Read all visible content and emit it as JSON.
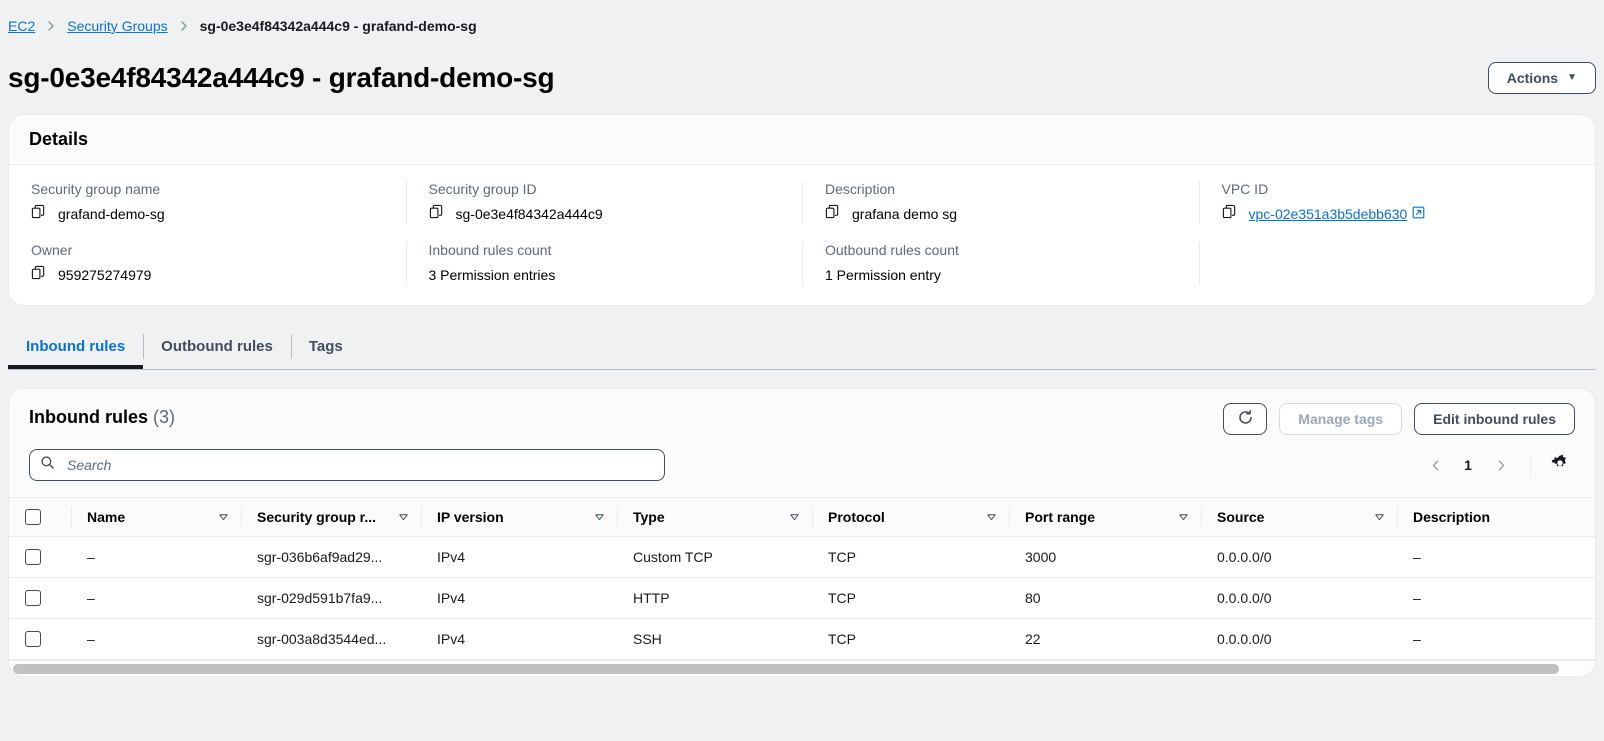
{
  "breadcrumb": {
    "items": [
      {
        "label": "EC2",
        "type": "link"
      },
      {
        "label": "Security Groups",
        "type": "link"
      },
      {
        "label": "sg-0e3e4f84342a444c9 - grafand-demo-sg",
        "type": "current"
      }
    ],
    "separator": "›"
  },
  "header": {
    "title": "sg-0e3e4f84342a444c9 - grafand-demo-sg",
    "actions_label": "Actions",
    "actions_caret": "▼"
  },
  "details": {
    "title": "Details",
    "fields": [
      {
        "label": "Security group name",
        "value": "grafand-demo-sg",
        "copyable": true,
        "link": false
      },
      {
        "label": "Security group ID",
        "value": "sg-0e3e4f84342a444c9",
        "copyable": true,
        "link": false
      },
      {
        "label": "Description",
        "value": "grafana demo sg",
        "copyable": true,
        "link": false
      },
      {
        "label": "VPC ID",
        "value": "vpc-02e351a3b5debb630",
        "copyable": true,
        "link": true
      },
      {
        "label": "Owner",
        "value": "959275274979",
        "copyable": true,
        "link": false
      },
      {
        "label": "Inbound rules count",
        "value": "3 Permission entries",
        "copyable": false,
        "link": false
      },
      {
        "label": "Outbound rules count",
        "value": "1 Permission entry",
        "copyable": false,
        "link": false
      },
      {
        "label": "",
        "value": "",
        "copyable": false,
        "link": false
      }
    ]
  },
  "tabs": [
    {
      "label": "Inbound rules",
      "active": true
    },
    {
      "label": "Outbound rules",
      "active": false
    },
    {
      "label": "Tags",
      "active": false
    }
  ],
  "table_panel": {
    "title": "Inbound rules",
    "count": "(3)",
    "refresh_icon": "refresh-icon",
    "manage_tags_label": "Manage tags",
    "manage_tags_disabled": true,
    "edit_rules_label": "Edit inbound rules",
    "search_placeholder": "Search",
    "search_value": "",
    "pagination": {
      "prev": "‹",
      "page": "1",
      "next": "›"
    },
    "settings_icon": "gear-icon"
  },
  "table": {
    "columns": [
      {
        "label": "Name",
        "sortable": true
      },
      {
        "label": "Security group r...",
        "sortable": true
      },
      {
        "label": "IP version",
        "sortable": true
      },
      {
        "label": "Type",
        "sortable": true
      },
      {
        "label": "Protocol",
        "sortable": true
      },
      {
        "label": "Port range",
        "sortable": true
      },
      {
        "label": "Source",
        "sortable": true
      },
      {
        "label": "Description",
        "sortable": false
      }
    ],
    "rows": [
      {
        "name": "–",
        "security_group_rule_id": "sgr-036b6af9ad29...",
        "ip_version": "IPv4",
        "type": "Custom TCP",
        "protocol": "TCP",
        "port_range": "3000",
        "source": "0.0.0.0/0",
        "description": "–"
      },
      {
        "name": "–",
        "security_group_rule_id": "sgr-029d591b7fa9...",
        "ip_version": "IPv4",
        "type": "HTTP",
        "protocol": "TCP",
        "port_range": "80",
        "source": "0.0.0.0/0",
        "description": "–"
      },
      {
        "name": "–",
        "security_group_rule_id": "sgr-003a8d3544ed...",
        "ip_version": "IPv4",
        "type": "SSH",
        "protocol": "TCP",
        "port_range": "22",
        "source": "0.0.0.0/0",
        "description": "–"
      }
    ]
  },
  "colors": {
    "link": "#0972d3",
    "page_background": "#f0f1f2",
    "panel": "#ffffff",
    "border": "#e9ebed",
    "text": "#16191f",
    "muted": "#5f6b7a",
    "active_tab_underline": "#16191f"
  }
}
